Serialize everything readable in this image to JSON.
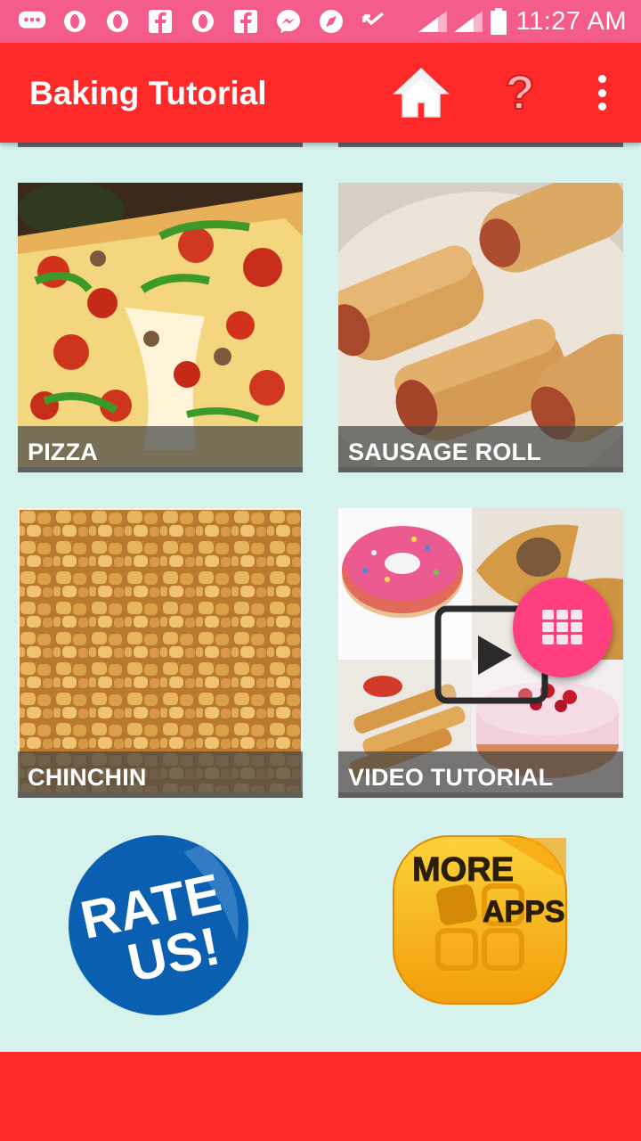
{
  "status_bar": {
    "time": "11:27 AM",
    "icons": [
      "message-icon",
      "opera-icon",
      "opera-icon",
      "facebook-icon",
      "opera-icon",
      "facebook-icon",
      "messenger-icon",
      "compass-icon",
      "missed-call-icon",
      "signal-icon",
      "signal-icon",
      "battery-icon"
    ]
  },
  "app_bar": {
    "title": "Baking Tutorial",
    "actions": [
      "home-icon",
      "help-icon",
      "overflow-menu-icon"
    ],
    "help_label": "?"
  },
  "tiles": [
    {
      "label": "PIZZA",
      "image": "pizza-photo"
    },
    {
      "label": "SAUSAGE ROLL",
      "image": "sausage-roll-photo"
    },
    {
      "label": "CHINCHIN",
      "image": "chinchin-photo"
    },
    {
      "label": "VIDEO TUTORIAL",
      "image": "video-tutorial-photo"
    }
  ],
  "fab": {
    "icon": "grid-icon"
  },
  "rate_us": {
    "line1": "RATE",
    "line2": "US!"
  },
  "more_apps": {
    "line1": "MORE",
    "line2": "APPS"
  },
  "colors": {
    "status_bar": "#f45c8b",
    "app_bar": "#fe2a2a",
    "background": "#d5f2ec",
    "fab": "#ff3f7f",
    "rate_us": "#0a5fb0",
    "more_apps": "#f5b800"
  }
}
